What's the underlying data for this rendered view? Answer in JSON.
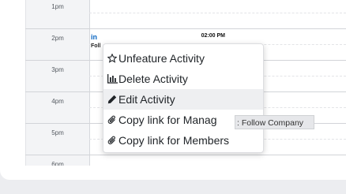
{
  "calendar": {
    "time_labels": [
      "1pm",
      "2pm",
      "3pm",
      "4pm",
      "5pm",
      "6pm"
    ],
    "event": {
      "source_icon": "in",
      "time": "02:00 PM",
      "title": "Foll"
    }
  },
  "context_menu": {
    "items": [
      {
        "label": "Unfeature Activity",
        "icon": "star-outline-icon"
      },
      {
        "label": "Delete Activity",
        "icon": "bar-chart-icon"
      },
      {
        "label": "Edit Activity",
        "icon": "pencil-icon"
      },
      {
        "label": "Copy link for Manag",
        "icon": "paperclip-icon"
      },
      {
        "label": "Copy link for Members",
        "icon": "paperclip-icon"
      }
    ],
    "active_index": 2
  },
  "tooltip": {
    "text": ": Follow Company"
  },
  "colors": {
    "linkedin_blue": "#0a66c2",
    "page_background": "#ecedf0",
    "time_column": "#f3f4f6",
    "menu_hover": "#eeeff1"
  }
}
